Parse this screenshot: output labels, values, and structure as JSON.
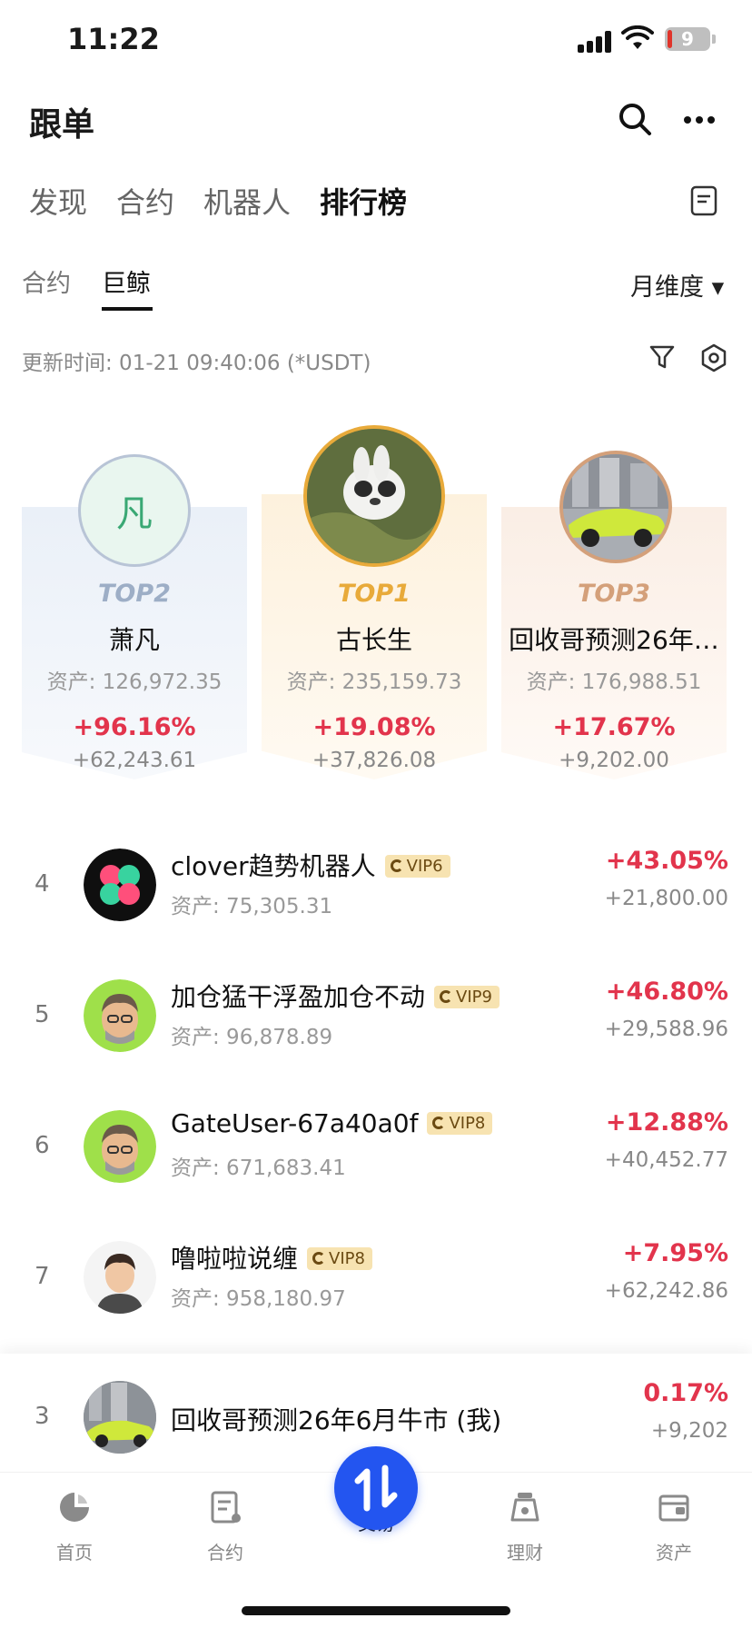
{
  "status_bar": {
    "time": "11:22",
    "battery": "9"
  },
  "header": {
    "title": "跟单"
  },
  "tabs": [
    {
      "label": "发现"
    },
    {
      "label": "合约"
    },
    {
      "label": "机器人"
    },
    {
      "label": "排行榜"
    }
  ],
  "subtabs": [
    {
      "label": "合约"
    },
    {
      "label": "巨鲸"
    }
  ],
  "dimension": "月维度 ▾",
  "update_time": "更新时间: 01-21 09:40:06 (*USDT)",
  "podium": {
    "top2": {
      "label": "TOP2",
      "avatar_char": "凡",
      "name": "萧凡",
      "asset": "资产: 126,972.35",
      "pct": "+96.16%",
      "pnl": "+62,243.61"
    },
    "top1": {
      "label": "TOP1",
      "name": "古长生",
      "asset": "资产: 235,159.73",
      "pct": "+19.08%",
      "pnl": "+37,826.08"
    },
    "top3": {
      "label": "TOP3",
      "name": "回收哥预测26年…",
      "asset": "资产: 176,988.51",
      "pct": "+17.67%",
      "pnl": "+9,202.00"
    }
  },
  "list": [
    {
      "rank": "4",
      "name": "clover趋势机器人",
      "vip": "VIP6",
      "asset": "资产: 75,305.31",
      "pct": "+43.05%",
      "pnl": "+21,800.00"
    },
    {
      "rank": "5",
      "name": "加仓猛干浮盈加仓不动",
      "vip": "VIP9",
      "asset": "资产: 96,878.89",
      "pct": "+46.80%",
      "pnl": "+29,588.96"
    },
    {
      "rank": "6",
      "name": "GateUser-67a40a0f",
      "vip": "VIP8",
      "asset": "资产: 671,683.41",
      "pct": "+12.88%",
      "pnl": "+40,452.77"
    },
    {
      "rank": "7",
      "name": "噜啦啦说缠",
      "vip": "VIP8",
      "asset": "资产: 958,180.97",
      "pct": "+7.95%",
      "pnl": "+62,242.86"
    }
  ],
  "my_rank": {
    "rank": "3",
    "name": "回收哥预测26年6月牛市 (我)",
    "pct": "0.17%",
    "pnl": "+9,202"
  },
  "bottom_nav": [
    {
      "label": "首页"
    },
    {
      "label": "合约"
    },
    {
      "label": "交易"
    },
    {
      "label": "理财"
    },
    {
      "label": "资产"
    }
  ],
  "colors": {
    "profit": "#e2344c",
    "accent": "#2355f0",
    "gold": "#e8aa3a"
  }
}
